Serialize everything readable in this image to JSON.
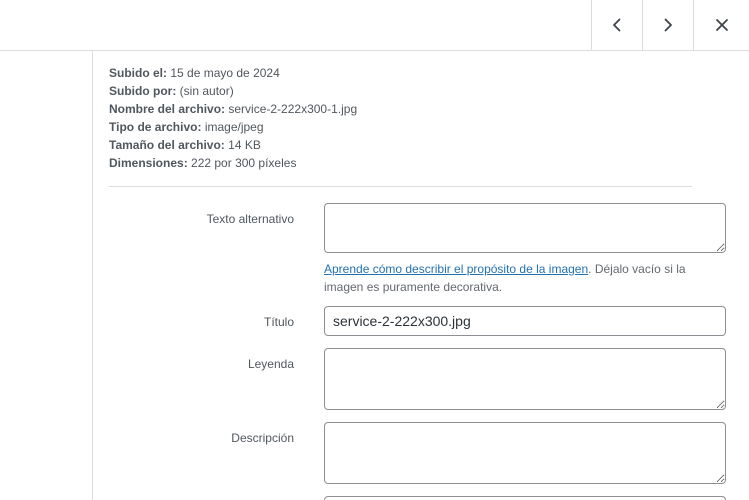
{
  "nav": {
    "prev_icon": "chevron-left-icon",
    "next_icon": "chevron-right-icon",
    "close_icon": "close-icon"
  },
  "details": {
    "uploaded_on_label": "Subido el:",
    "uploaded_on_value": "15 de mayo de 2024",
    "uploaded_by_label": "Subido por:",
    "uploaded_by_value": "(sin autor)",
    "file_name_label": "Nombre del archivo:",
    "file_name_value": "service-2-222x300-1.jpg",
    "file_type_label": "Tipo de archivo:",
    "file_type_value": "image/jpeg",
    "file_size_label": "Tamaño del archivo:",
    "file_size_value": "14 KB",
    "dimensions_label": "Dimensiones:",
    "dimensions_value": "222 por 300 píxeles"
  },
  "form": {
    "alt_label": "Texto alternativo",
    "alt_value": "",
    "help_link": "Aprende cómo describir el propósito de la imagen",
    "help_text": ". Déjalo vacío si la imagen es puramente decorativa.",
    "title_label": "Título",
    "title_value": "service-2-222x300.jpg",
    "caption_label": "Leyenda",
    "caption_value": "",
    "description_label": "Descripción",
    "description_value": ""
  },
  "colors": {
    "link": "#2271b1",
    "border": "#dcdcde",
    "input_border": "#8c8f94"
  }
}
